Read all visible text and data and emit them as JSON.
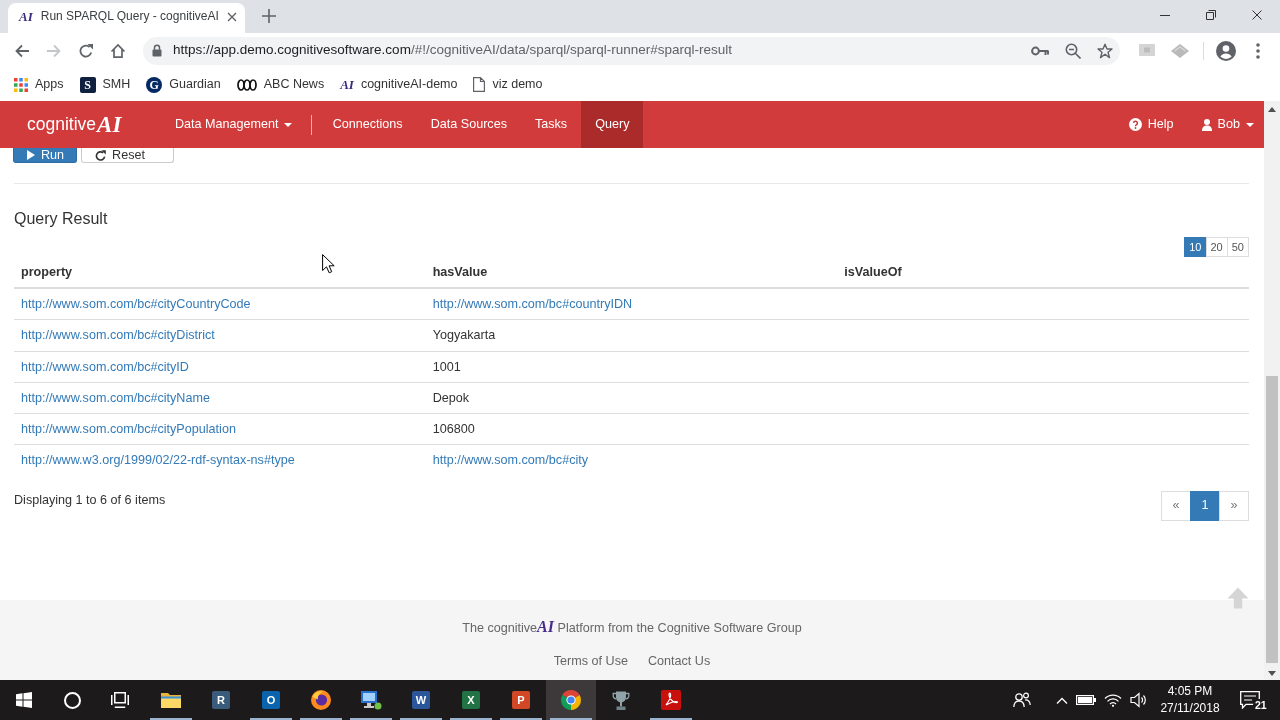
{
  "browser": {
    "tabs": [
      {
        "title": "Run SPARQL Query - cognitiveAI",
        "logo": "AI",
        "selected": true
      }
    ],
    "nav_buttons": [
      {
        "kind": "back",
        "disabled": false
      },
      {
        "kind": "forward",
        "disabled": true
      },
      {
        "kind": "reload",
        "disabled": false
      },
      {
        "kind": "home",
        "disabled": false
      }
    ],
    "address": {
      "origin": "https://app.demo.cognitivesoftware.com",
      "path": "/#!/cognitiveAI/data/sparql/sparql-runner#sparql-result"
    },
    "bookmarks": [
      {
        "kind": "apps",
        "label": "Apps"
      },
      {
        "kind": "letter-tile",
        "glyph": "S",
        "label": "SMH"
      },
      {
        "kind": "letter-circle",
        "glyph": "G",
        "label": "Guardian"
      },
      {
        "kind": "loops",
        "label": "ABC News"
      },
      {
        "kind": "wordmark",
        "glyph": "AI",
        "label": "cognitiveAI-demo"
      },
      {
        "kind": "page",
        "label": "viz demo"
      }
    ]
  },
  "app": {
    "brand": "cognitive**AI**",
    "nav": [
      {
        "label": "Data Management",
        "dropdown": true,
        "separator_after": true,
        "selected": false
      },
      {
        "label": "Connections",
        "dropdown": false,
        "separator_after": false,
        "selected": false
      },
      {
        "label": "Data Sources",
        "dropdown": false,
        "separator_after": false,
        "selected": false
      },
      {
        "label": "Tasks",
        "dropdown": false,
        "separator_after": false,
        "selected": false
      },
      {
        "label": "Query",
        "dropdown": false,
        "separator_after": false,
        "selected": true
      }
    ],
    "nav_right": [
      {
        "kind": "help",
        "label": "Help",
        "dropdown": false
      },
      {
        "kind": "user",
        "label": "Bob",
        "dropdown": true
      }
    ],
    "actions": [
      {
        "kind": "run",
        "label": "Run"
      },
      {
        "kind": "reset",
        "label": "Reset"
      }
    ],
    "result": {
      "title": "Query Result",
      "page_sizes": [
        {
          "label": "10",
          "selected": true
        },
        {
          "label": "20",
          "selected": false
        },
        {
          "label": "50",
          "selected": false
        }
      ],
      "columns": [
        "property",
        "hasValue",
        "isValueOf"
      ],
      "rows": [
        [
          {
            "text": "http://www.som.com/bc#cityCountryCode",
            "link": true
          },
          {
            "text": "http://www.som.com/bc#countryIDN",
            "link": true
          }
        ],
        [
          {
            "text": "http://www.som.com/bc#cityDistrict",
            "link": true
          },
          {
            "text": "Yogyakarta",
            "link": false
          }
        ],
        [
          {
            "text": "http://www.som.com/bc#cityID",
            "link": true
          },
          {
            "text": "1001",
            "link": false
          }
        ],
        [
          {
            "text": "http://www.som.com/bc#cityName",
            "link": true
          },
          {
            "text": "Depok",
            "link": false
          }
        ],
        [
          {
            "text": "http://www.som.com/bc#cityPopulation",
            "link": true
          },
          {
            "text": "106800",
            "link": false
          }
        ],
        [
          {
            "text": "http://www.w3.org/1999/02/22-rdf-syntax-ns#type",
            "link": true
          },
          {
            "text": "http://www.som.com/bc#city",
            "link": true
          }
        ]
      ],
      "summary": "Displaying 1 to 6 of 6 items",
      "pagination": {
        "previous": "«",
        "pages": [
          {
            "label": "1",
            "selected": true
          }
        ],
        "next": "»"
      }
    },
    "footer": {
      "text": "The cognitive**AI** Platform from the Cognitive Software Group",
      "links": [
        "Terms of Use",
        "Contact Us"
      ]
    }
  },
  "taskbar": {
    "apps": [
      {
        "kind": "explorer",
        "running": true,
        "selected": false
      },
      {
        "kind": "r",
        "glyph": "R",
        "running": false,
        "selected": false
      },
      {
        "kind": "outlook",
        "glyph": "O",
        "running": true,
        "selected": false
      },
      {
        "kind": "firefox",
        "running": true,
        "selected": false
      },
      {
        "kind": "remote",
        "running": true,
        "selected": false
      },
      {
        "kind": "word",
        "glyph": "W",
        "running": true,
        "selected": false
      },
      {
        "kind": "excel",
        "glyph": "X",
        "running": true,
        "selected": false
      },
      {
        "kind": "powerpoint",
        "glyph": "P",
        "running": true,
        "selected": false
      },
      {
        "kind": "chrome",
        "running": true,
        "selected": true
      },
      {
        "kind": "trophy",
        "running": false,
        "selected": false
      },
      {
        "kind": "acrobat",
        "running": true,
        "selected": false
      }
    ],
    "clock": {
      "time": "4:05 PM",
      "date": "27/11/2018"
    },
    "notification_count": "21"
  }
}
